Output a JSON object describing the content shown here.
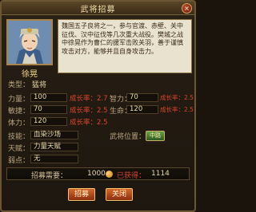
{
  "dialog": {
    "title": "武将招募",
    "close_label": "×"
  },
  "hero": {
    "name": "徐晃",
    "bio": "魏国五子良将之一，参与官渡、赤壁、关中征伐、汉中征伐等几次重大战役。樊城之战中徐晃作为曹仁的援军击败关羽，善于谨慎攻击对方，能够并且自身攻击力。"
  },
  "labels": {
    "type": "类型：",
    "strength": "力量：",
    "agility": "敏捷：",
    "stamina": "体力：",
    "intelligence": "智力：",
    "health": "生命：",
    "skill": "技能：",
    "talent": "天赋：",
    "weakness": "弱点：",
    "position": "武将位置：",
    "cost": "招募需要：",
    "owned": "已获得："
  },
  "stats": {
    "type": "猛将",
    "strength": "100",
    "strength_growth": "成长率：2.7",
    "agility": "70",
    "agility_growth": "成长率：2.5",
    "stamina": "120",
    "stamina_growth": "成长率：2.5",
    "intelligence": "70",
    "intelligence_growth": "成长率：2.5",
    "health": "120",
    "health_growth": "成长率：2.5",
    "skill": "血染沙场",
    "talent": "力量天赋",
    "weakness": "无",
    "position_badge": "中路"
  },
  "recruit": {
    "cost": "1000",
    "owned": "1114"
  },
  "buttons": {
    "confirm": "招募",
    "cancel": "关闭"
  },
  "colors": {
    "panel": "#231b12",
    "gold_text": "#f2d48a",
    "growth_red": "#d7452a",
    "button": "#d46a2a"
  }
}
